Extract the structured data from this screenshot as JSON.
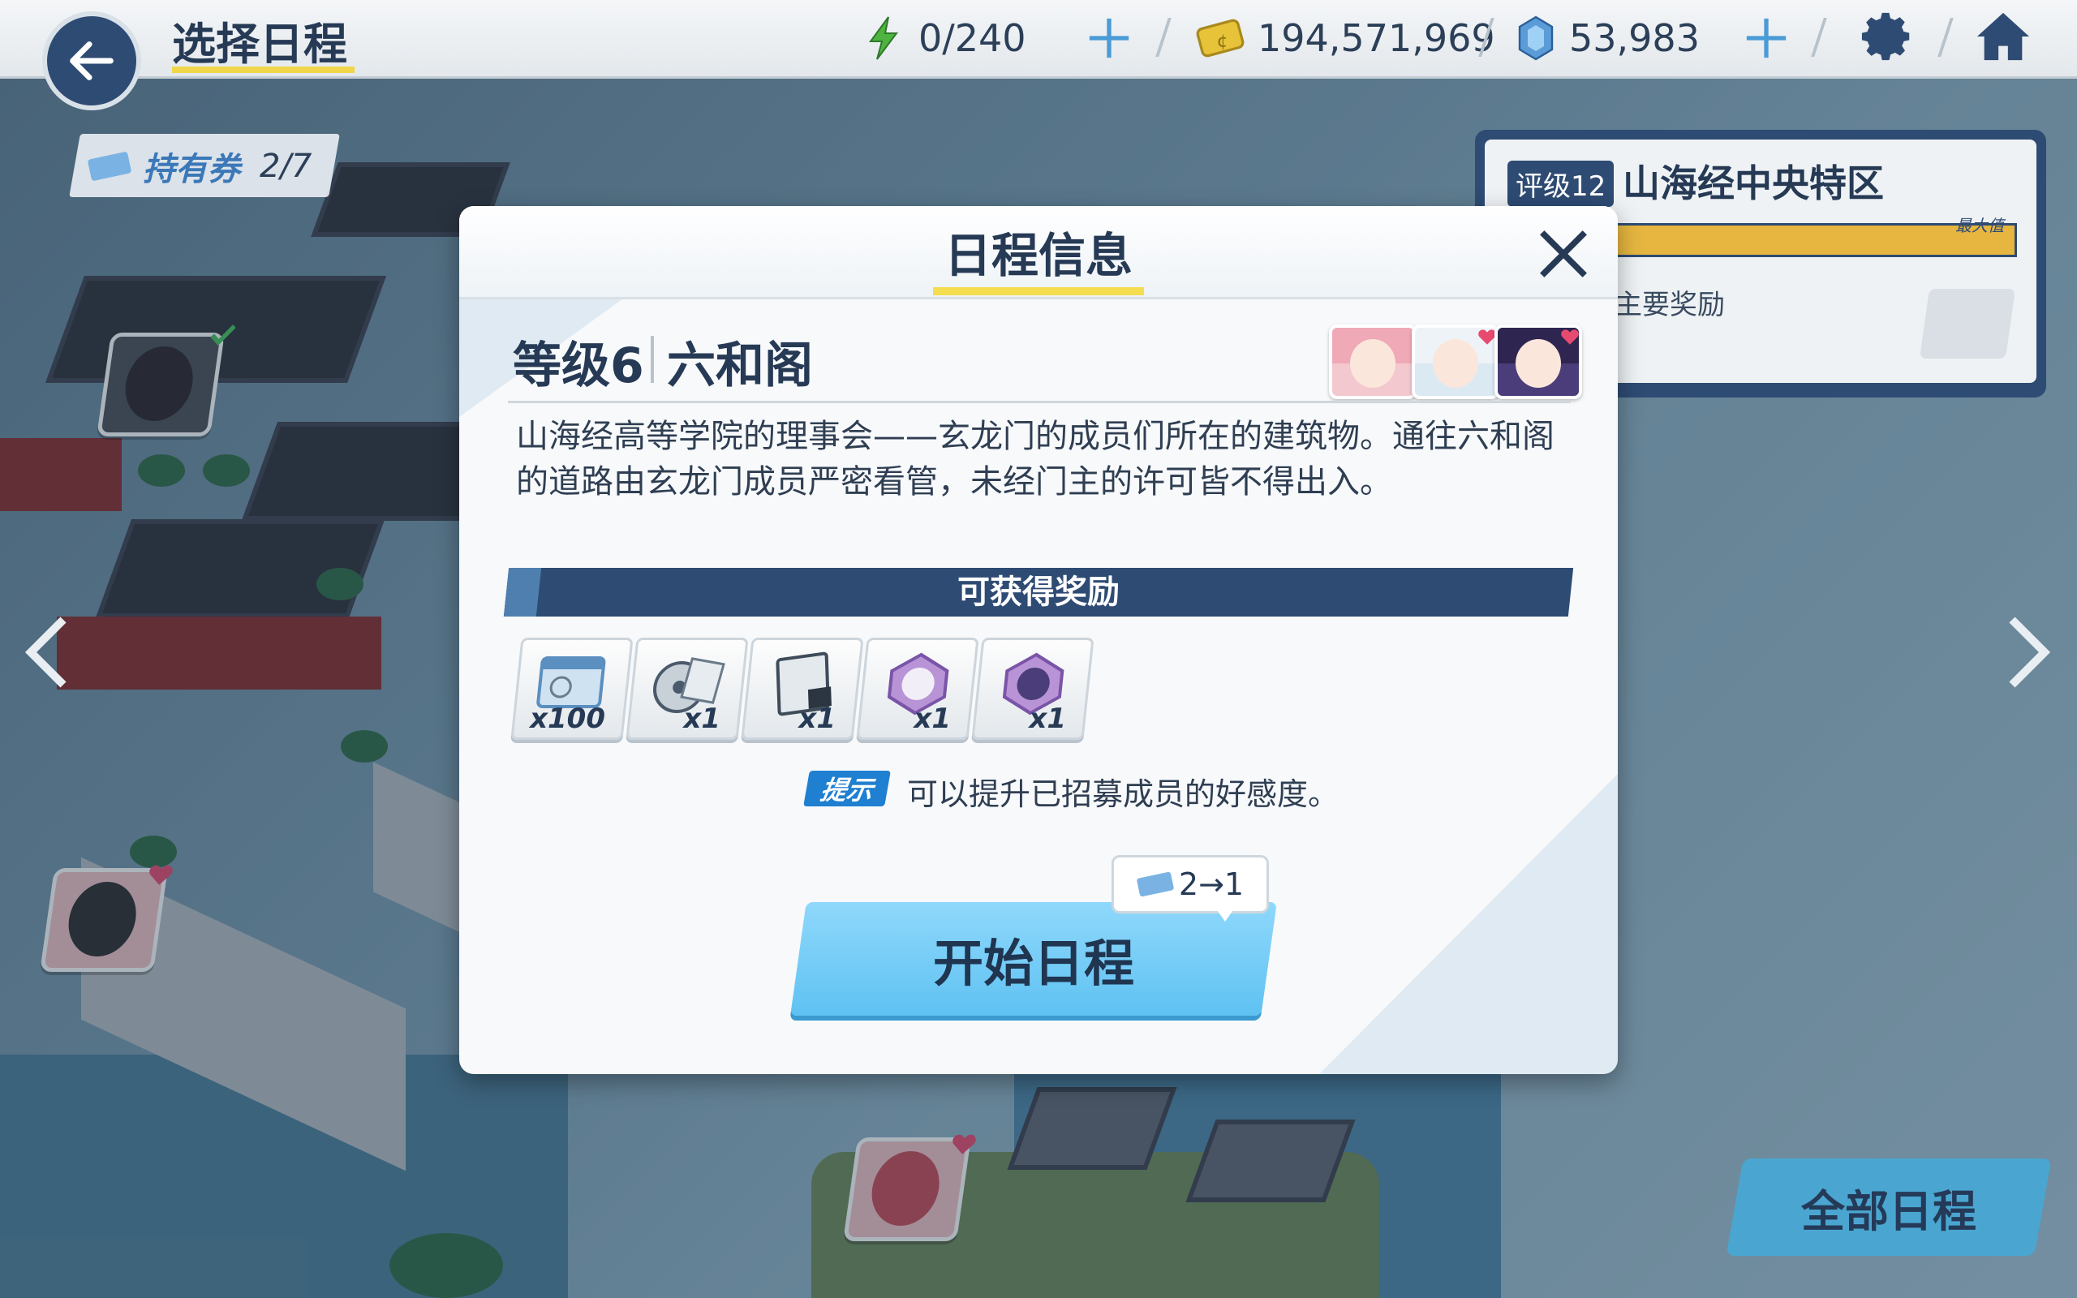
{
  "header": {
    "title": "选择日程",
    "ap": "0/240",
    "credits": "194,571,969",
    "pyroxene": "53,983"
  },
  "ticket": {
    "label": "持有券",
    "count": "2/7"
  },
  "area": {
    "grade": "评级12",
    "name": "山海经中央特区",
    "max_label": "最大值",
    "reward_label": "主要奖励"
  },
  "modal": {
    "title": "日程信息",
    "level": "等级6",
    "place": "六和阁",
    "description": "山海经高等学院的理事会——玄龙门的成员们所在的建筑物。通往六和阁的道路由玄龙门成员严密看管，未经门主的许可皆不得出入。",
    "rewards_title": "可获得奖励",
    "rewards": [
      {
        "icon": "exp-report-icon",
        "qty": "x100"
      },
      {
        "icon": "disc-item-icon",
        "qty": "x1"
      },
      {
        "icon": "book-item-icon",
        "qty": "x1"
      },
      {
        "icon": "student-gift-white-icon",
        "qty": "x1"
      },
      {
        "icon": "student-gift-purple-icon",
        "qty": "x1"
      }
    ],
    "hint_badge": "提示",
    "hint_text": "可以提升已招募成员的好感度。",
    "cost": "2→1",
    "start_label": "开始日程"
  },
  "all_schedules_label": "全部日程",
  "colors": {
    "navy": "#2e4b73",
    "accent_yellow": "#f4dd4e",
    "button_blue": "#6cc9f5"
  }
}
